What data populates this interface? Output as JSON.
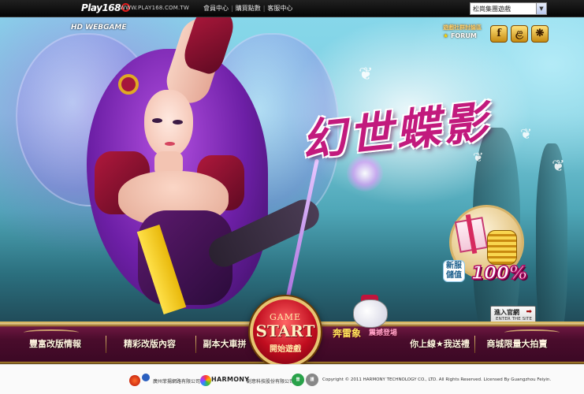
{
  "topbar": {
    "logo_text": "Play168",
    "site_url": "WWW.PLAY168.COM.TW",
    "links": [
      "會員中心",
      "購買點數",
      "客服中心"
    ],
    "game_select_value": "松崗集團遊戲"
  },
  "hero": {
    "hd_logo": "HD WEBGAME",
    "title": "幻世蝶影",
    "forum_cn": "遊戲社群討論區",
    "forum_en": "FORUM",
    "social_icons": [
      "facebook-icon",
      "plurk-icon",
      "share-icon"
    ],
    "promo_label_line1": "新服",
    "promo_label_line2": "儲值",
    "promo_percent": "100%",
    "enter_site_cn": "進入官網",
    "enter_site_en": "ENTER THE SITE"
  },
  "nav": {
    "items_left": [
      "豐富改版情報",
      "精彩改版內容",
      "副本大車拼"
    ],
    "items_right": [
      "你上線★我送禮",
      "商城限量大拍賣"
    ],
    "game_start_top": "GAME",
    "game_start_main": "START",
    "game_start_cn": "開始遊戲",
    "event_main": "奔雷象",
    "event_sub": "震撼登場"
  },
  "footer": {
    "company1": "廣州菲揚網路有限公司",
    "harmony_brand": "HARMONY",
    "company2": "創意科技股份有限公司",
    "copyright": "Copyright © 2011 HARMONY TECHNOLOGY CO., LTD. All Rights Reserved. Licensed By Guangzhou Feiyin."
  }
}
